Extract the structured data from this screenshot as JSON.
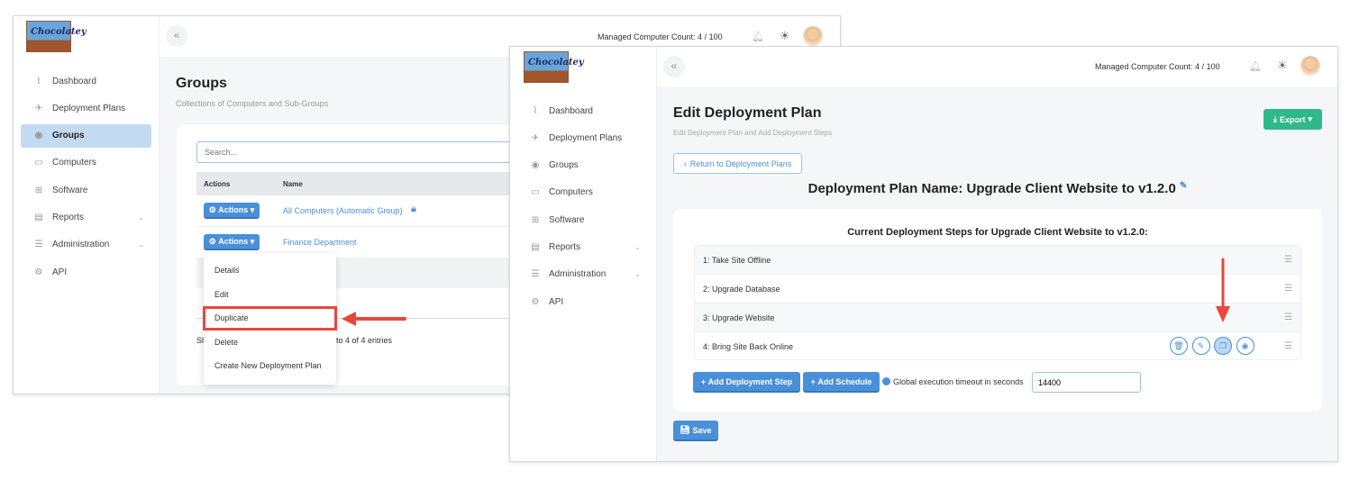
{
  "back_window": {
    "logo_text": "Chocolatey",
    "header": {
      "managed_count": "Managed Computer Count: 4 / 100"
    },
    "sidebar": {
      "items": [
        {
          "label": "Dashboard",
          "icon": "chart-line-icon"
        },
        {
          "label": "Deployment Plans",
          "icon": "paper-plane-icon"
        },
        {
          "label": "Groups",
          "icon": "layers-icon",
          "active": true
        },
        {
          "label": "Computers",
          "icon": "monitor-icon"
        },
        {
          "label": "Software",
          "icon": "grid-icon"
        },
        {
          "label": "Reports",
          "icon": "file-icon",
          "expandable": true
        },
        {
          "label": "Administration",
          "icon": "sliders-icon",
          "expandable": true
        },
        {
          "label": "API",
          "icon": "gear-icon"
        }
      ]
    },
    "page_title": "Groups",
    "page_subtitle": "Collections of Computers and Sub-Groups",
    "search_placeholder": "Search...",
    "table": {
      "columns": [
        "Actions",
        "Name"
      ],
      "rows": [
        {
          "action": "Actions",
          "name": "All Computers (Automatic Group)",
          "locked": true
        },
        {
          "action": "Actions",
          "name": "Finance Department"
        }
      ]
    },
    "footer_prefix": "Sh",
    "footer_suffix": "to 4 of 4 entries",
    "dropdown": [
      "Details",
      "Edit",
      "Duplicate",
      "Delete",
      "Create New Deployment Plan"
    ],
    "highlighted_item": "Duplicate",
    "annotation_color": "#e8473b"
  },
  "front_window": {
    "logo_text": "Chocolatey",
    "header": {
      "managed_count": "Managed Computer Count: 4 / 100"
    },
    "sidebar": {
      "items": [
        {
          "label": "Dashboard"
        },
        {
          "label": "Deployment Plans"
        },
        {
          "label": "Groups"
        },
        {
          "label": "Computers"
        },
        {
          "label": "Software"
        },
        {
          "label": "Reports"
        },
        {
          "label": "Administration"
        },
        {
          "label": "API"
        }
      ]
    },
    "page_title": "Edit Deployment Plan",
    "page_subtitle": "Edit Deployment Plan and Add Deployment Steps",
    "export_label": "Export",
    "return_label": "Return to Deployment Plans",
    "plan_name": "Deployment Plan Name: Upgrade Client Website to v1.2.0",
    "steps_title": "Current Deployment Steps for Upgrade Client Website to v1.2.0:",
    "steps": [
      "1: Take Site Offline",
      "2: Upgrade Database",
      "3: Upgrade Website",
      "4: Bring Site Back Online"
    ],
    "add_step_label": "Add Deployment Step",
    "add_schedule_label": "Add Schedule",
    "timeout_label": "Global execution timeout in seconds",
    "timeout_value": "14400",
    "save_label": "Save",
    "colors": {
      "primary": "#4a90d9",
      "export": "#2fb98a"
    }
  }
}
